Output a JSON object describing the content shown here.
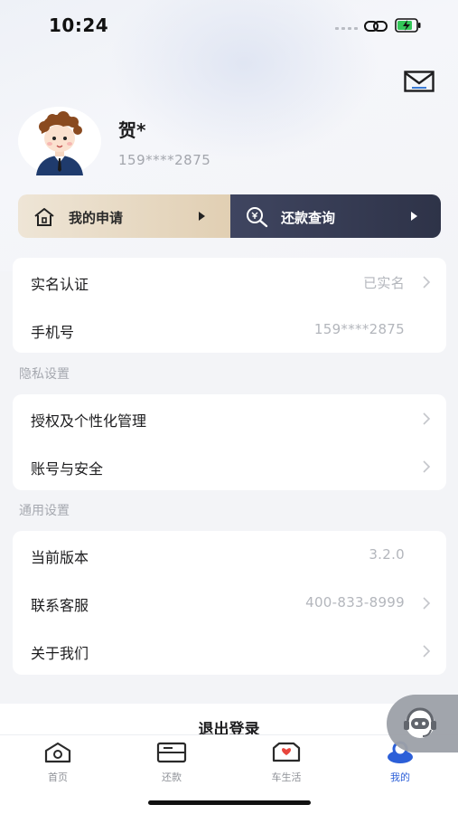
{
  "status_bar": {
    "time": "10:24"
  },
  "profile": {
    "name": "贺*",
    "phone": "159****2875"
  },
  "quick_actions": {
    "my_application": "我的申请",
    "repayment_query": "还款查询"
  },
  "account_card": {
    "items": [
      {
        "label": "实名认证",
        "value": "已实名"
      },
      {
        "label": "手机号",
        "value": "159****2875"
      }
    ]
  },
  "privacy": {
    "title": "隐私设置",
    "items": [
      {
        "label": "授权及个性化管理"
      },
      {
        "label": "账号与安全"
      }
    ]
  },
  "general": {
    "title": "通用设置",
    "items": [
      {
        "label": "当前版本",
        "value": "3.2.0"
      },
      {
        "label": "联系客服",
        "value": "400-833-8999"
      },
      {
        "label": "关于我们"
      }
    ]
  },
  "logout": {
    "label": "退出登录"
  },
  "tabbar": {
    "items": [
      {
        "label": "首页",
        "icon": "home-icon"
      },
      {
        "label": "还款",
        "icon": "repay-card-icon"
      },
      {
        "label": "车生活",
        "icon": "car-life-icon"
      },
      {
        "label": "我的",
        "icon": "profile-icon",
        "active": true
      }
    ]
  },
  "colors": {
    "accent": "#2c5fd8",
    "gold_start": "#eee5d6",
    "gold_end": "#e1cfb3",
    "dark_start": "#3f4560",
    "dark_end": "#2e3348"
  }
}
